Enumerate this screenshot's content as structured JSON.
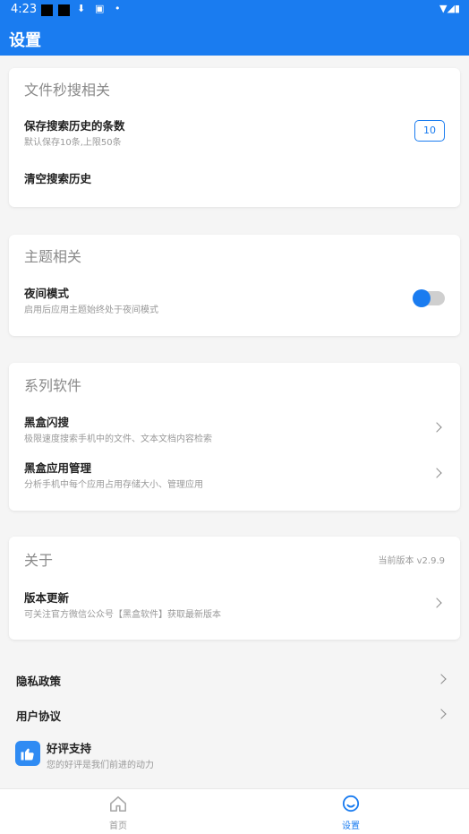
{
  "status_bar": {
    "time": "4:23"
  },
  "app_bar": {
    "title": "设置"
  },
  "search_card": {
    "title": "文件秒搜相关",
    "history_count": {
      "label": "保存搜索历史的条数",
      "sub": "默认保存10条,上限50条",
      "value": "10"
    },
    "clear_history": {
      "label": "清空搜索历史"
    }
  },
  "theme_card": {
    "title": "主题相关",
    "night_mode": {
      "label": "夜间模式",
      "sub": "启用后应用主题始终处于夜间模式"
    }
  },
  "series_card": {
    "title": "系列软件",
    "items": [
      {
        "label": "黑盒闪搜",
        "sub": "极限速度搜索手机中的文件、文本文档内容检索"
      },
      {
        "label": "黑盒应用管理",
        "sub": "分析手机中每个应用占用存储大小、管理应用"
      }
    ]
  },
  "about_card": {
    "title": "关于",
    "version": "当前版本 v2.9.9",
    "update": {
      "label": "版本更新",
      "sub": "可关注官方微信公众号【黑盒软件】获取最新版本"
    }
  },
  "plain_rows": {
    "privacy": "隐私政策",
    "agreement": "用户协议",
    "rate": {
      "label": "好评支持",
      "sub": "您的好评是我们前进的动力"
    }
  },
  "bottom_nav": {
    "home": "首页",
    "settings": "设置"
  },
  "colors": {
    "accent": "#1a7cf0",
    "background": "#f5f5f5"
  }
}
